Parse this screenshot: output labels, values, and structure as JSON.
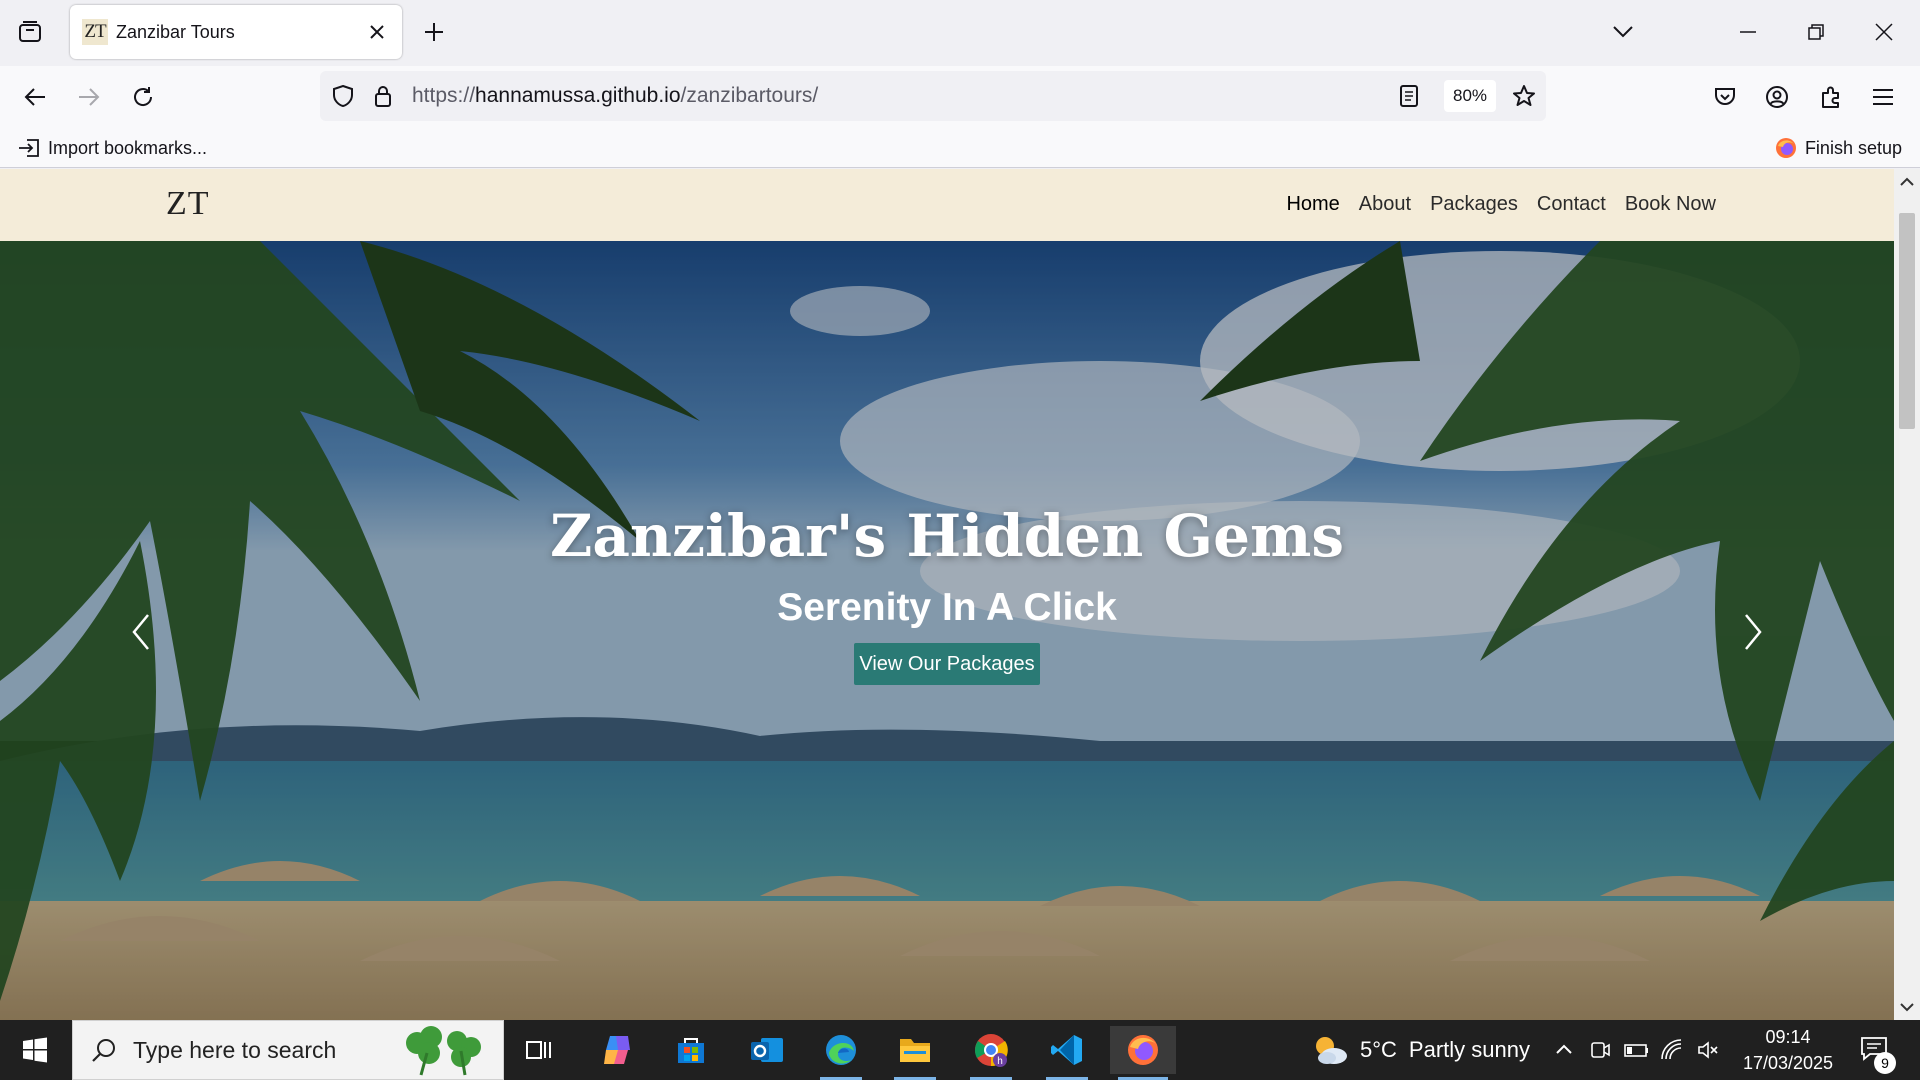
{
  "browser": {
    "tab": {
      "title": "Zanzibar Tours",
      "favicon_text": "ZT"
    },
    "url": {
      "prefix": "https://",
      "host": "hannamussa.github.io",
      "path": "/zanzibartours/"
    },
    "zoom": "80%",
    "bookmarks": {
      "import": "Import bookmarks...",
      "finish_setup": "Finish setup"
    },
    "icons": [
      "tab-list-icon",
      "new-tab-icon",
      "list-all-tabs-icon",
      "minimize-icon",
      "restore-icon",
      "close-window-icon",
      "back-icon",
      "forward-icon",
      "reload-icon",
      "shield-icon",
      "lock-icon",
      "reader-view-icon",
      "bookmark-star-icon",
      "pocket-icon",
      "account-icon",
      "extensions-icon",
      "menu-icon"
    ]
  },
  "site": {
    "logo": "ZT",
    "nav": [
      "Home",
      "About",
      "Packages",
      "Contact",
      "Book Now"
    ],
    "active_nav": "Home",
    "hero": {
      "title": "Zanzibar's Hidden Gems",
      "subtitle": "Serenity In A Click",
      "cta": "View Our Packages"
    }
  },
  "taskbar": {
    "search_placeholder": "Type here to search",
    "weather": {
      "temp": "5°C",
      "text": "Partly sunny"
    },
    "time": "09:14",
    "date": "17/03/2025",
    "notifications": "9",
    "apps": [
      "task-view",
      "copilot",
      "microsoft-store",
      "outlook",
      "edge",
      "file-explorer",
      "chrome",
      "vscode",
      "firefox"
    ]
  },
  "colors": {
    "nav_bg": "#f4ecd9",
    "cta_bg": "#2a7a75",
    "taskbar_bg": "#202020"
  }
}
